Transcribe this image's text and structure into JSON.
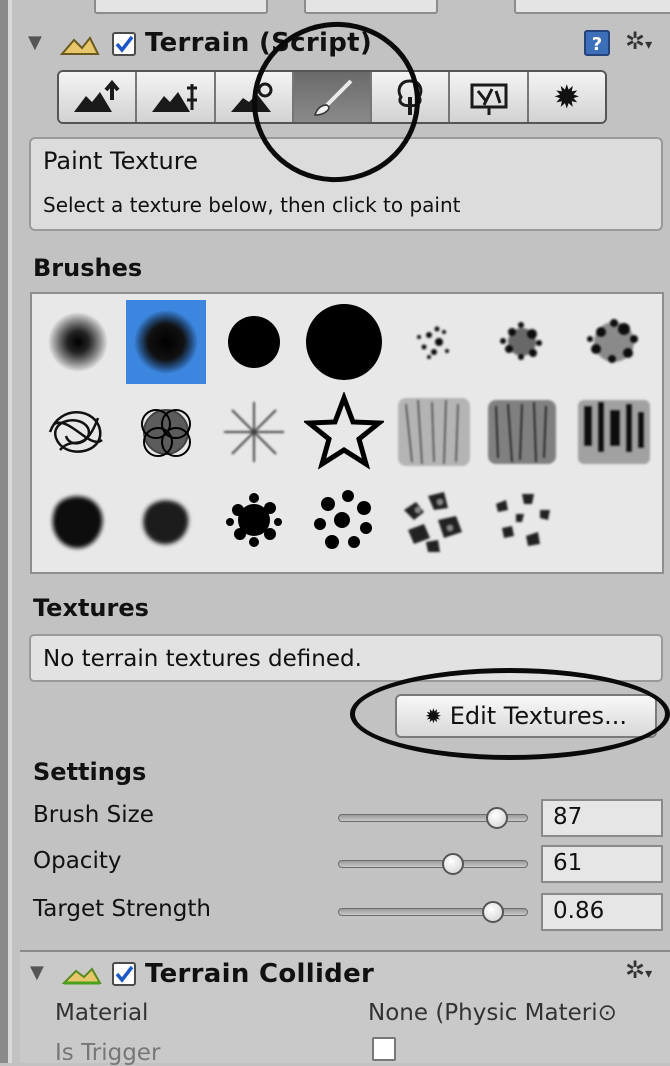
{
  "terrain_component": {
    "title": "Terrain (Script)",
    "enabled": true,
    "help_label": "?",
    "tools": [
      {
        "name": "raise-lower-terrain-tool",
        "icon": "mountain-up-arrow-icon",
        "active": false
      },
      {
        "name": "paint-height-tool",
        "icon": "mountain-height-icon",
        "active": false
      },
      {
        "name": "smooth-height-tool",
        "icon": "mountain-smooth-icon",
        "active": false
      },
      {
        "name": "paint-texture-tool",
        "icon": "paintbrush-icon",
        "active": true
      },
      {
        "name": "place-trees-tool",
        "icon": "tree-icon",
        "active": false
      },
      {
        "name": "paint-details-tool",
        "icon": "grass-detail-icon",
        "active": false
      },
      {
        "name": "terrain-settings-tool",
        "icon": "gear-icon",
        "active": false
      }
    ],
    "info_title": "Paint Texture",
    "info_subtitle": "Select a texture below, then click to paint",
    "brushes_label": "Brushes",
    "brushes": [
      {
        "icon": "soft-small-brush",
        "selected": false
      },
      {
        "icon": "soft-medium-brush",
        "selected": true
      },
      {
        "icon": "hard-medium-brush",
        "selected": false
      },
      {
        "icon": "hard-large-brush",
        "selected": false
      },
      {
        "icon": "scatter-light-brush",
        "selected": false
      },
      {
        "icon": "scatter-dense-brush",
        "selected": false
      },
      {
        "icon": "scatter-heavy-brush",
        "selected": false
      },
      {
        "icon": "scribble-brush",
        "selected": false
      },
      {
        "icon": "swirl-brush",
        "selected": false
      },
      {
        "icon": "starburst-brush",
        "selected": false
      },
      {
        "icon": "star-outline-brush",
        "selected": false
      },
      {
        "icon": "grunge-light-brush",
        "selected": false
      },
      {
        "icon": "grunge-dense-brush",
        "selected": false
      },
      {
        "icon": "grunge-streak-brush",
        "selected": false
      },
      {
        "icon": "smudge-brush",
        "selected": false
      },
      {
        "icon": "smudge-soft-brush",
        "selected": false
      },
      {
        "icon": "splatter-brush",
        "selected": false
      },
      {
        "icon": "dots-brush",
        "selected": false
      },
      {
        "icon": "rock-cluster-brush",
        "selected": false
      },
      {
        "icon": "rock-scatter-brush",
        "selected": false
      }
    ],
    "textures_label": "Textures",
    "textures_empty": "No terrain textures defined.",
    "edit_textures_label": "Edit Textures...",
    "settings_label": "Settings",
    "settings": [
      {
        "label": "Brush Size",
        "value": "87",
        "slider_fraction": 0.84
      },
      {
        "label": "Opacity",
        "value": "61",
        "slider_fraction": 0.61
      },
      {
        "label": "Target Strength",
        "value": "0.86",
        "slider_fraction": 0.84
      }
    ]
  },
  "collider_component": {
    "title": "Terrain Collider",
    "enabled": true,
    "properties": [
      {
        "label": "Material",
        "value": "None (Physic Materi⊙"
      },
      {
        "label": "Is Trigger",
        "value": ""
      }
    ]
  }
}
